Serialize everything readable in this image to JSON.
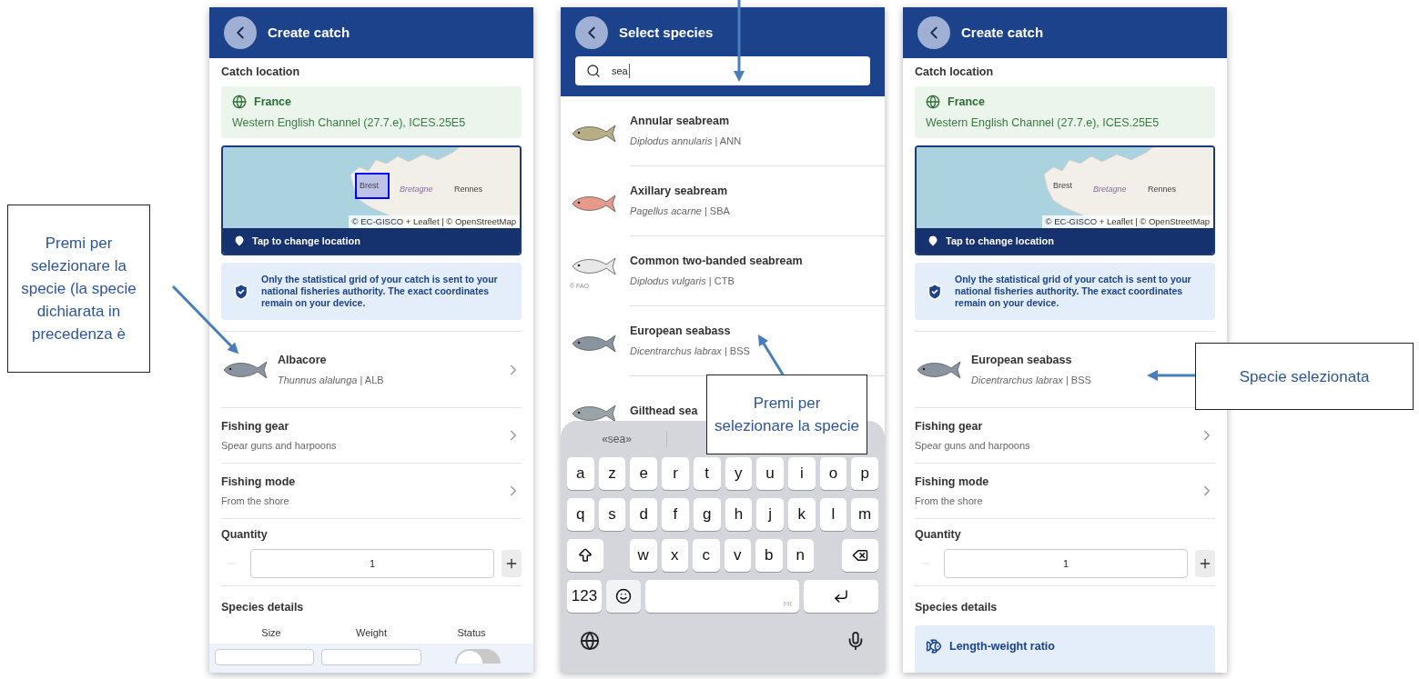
{
  "screens": [
    {
      "kind": "form",
      "title": "Create catch",
      "location": {
        "label": "Catch location",
        "country": "France",
        "area": "Western English Channel (27.7.e), ICES.25E5",
        "map_labels": [
          "Brest",
          "Bretagne",
          "Rennes"
        ],
        "attribution": "© EC-GISCO + Leaflet | © OpenStreetMap",
        "selected_cell": true,
        "action": "Tap to change location"
      },
      "notice": "Only the statistical grid of your catch is sent to your national fisheries authority. The exact coordinates remain on your device.",
      "species": {
        "name": "Albacore",
        "subtitle": "*Thunnus alalunga* | ALB",
        "chevron": true
      },
      "rows": [
        {
          "title": "Fishing gear",
          "value": "Spear guns and harpoons"
        },
        {
          "title": "Fishing mode",
          "value": "From the shore"
        }
      ],
      "quantity": {
        "label": "Quantity",
        "value": "1",
        "decrement_disabled": true
      },
      "details": {
        "title": "Species details",
        "columns": [
          "Size",
          "Weight",
          "Status"
        ],
        "status_on": false
      }
    },
    {
      "kind": "species_search",
      "title": "Select species",
      "search": {
        "value": "sea"
      },
      "items": [
        {
          "name": "Annular seabream",
          "subtitle": "*Diplodus annularis* | ANN"
        },
        {
          "name": "Axillary seabream",
          "subtitle": "*Pagellus acarne* | SBA"
        },
        {
          "name": "Common two-banded seabream",
          "subtitle": "*Diplodus vulgaris* | CTB",
          "credit": "© FAO"
        },
        {
          "name": "European seabass",
          "subtitle": "*Dicentrarchus labrax* | BSS"
        },
        {
          "name": "Gilthead sea"
        }
      ],
      "keyboard": {
        "suggestion": "«sea»",
        "rows": [
          [
            "a",
            "z",
            "e",
            "r",
            "t",
            "y",
            "u",
            "i",
            "o",
            "p"
          ],
          [
            "q",
            "s",
            "d",
            "f",
            "g",
            "h",
            "j",
            "k",
            "l",
            "m"
          ]
        ],
        "bottom_letters": [
          "w",
          "x",
          "c",
          "v",
          "b",
          "n"
        ],
        "numbers_key": "123",
        "space_label": "FR"
      }
    },
    {
      "kind": "form",
      "title": "Create catch",
      "location": {
        "label": "Catch location",
        "country": "France",
        "area": "Western English Channel (27.7.e), ICES.25E5",
        "map_labels": [
          "Brest",
          "Bretagne",
          "Rennes"
        ],
        "attribution": "© EC-GISCO + Leaflet | © OpenStreetMap",
        "selected_cell": false,
        "action": "Tap to change location"
      },
      "notice": "Only the statistical grid of your catch is sent to your national fisheries authority. The exact coordinates remain on your device.",
      "species": {
        "name": "European seabass",
        "subtitle": "*Dicentrarchus labrax* | BSS"
      },
      "rows": [
        {
          "title": "Fishing gear",
          "value": "Spear guns and harpoons"
        },
        {
          "title": "Fishing mode",
          "value": "From the shore"
        }
      ],
      "quantity": {
        "label": "Quantity",
        "value": "1",
        "decrement_disabled": true
      },
      "details": {
        "title": "Species details",
        "card": {
          "title": "Length-weight ratio"
        }
      }
    }
  ],
  "annotations": [
    {
      "text": "Premi per selezionare la specie (la specie dichiarata in precedenza è"
    },
    {
      "text": "Premi per selezionare la specie"
    },
    {
      "text": "Specie selezionata"
    }
  ]
}
